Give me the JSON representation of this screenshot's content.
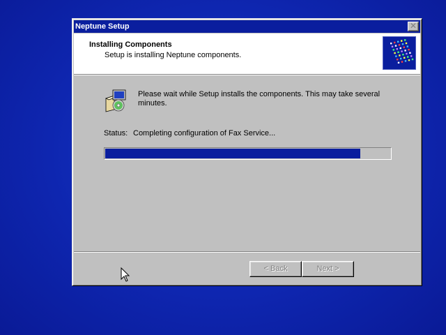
{
  "window": {
    "title": "Neptune Setup",
    "close_symbol": "✕"
  },
  "header": {
    "title": "Installing Components",
    "subtitle": "Setup is installing Neptune components.",
    "logo_icon": "setup-logo-icon"
  },
  "content": {
    "icon": "setup-computer-icon",
    "message": "Please wait while Setup installs the components.  This may take several minutes.",
    "status_label": "Status:",
    "status_value": "Completing configuration of Fax Service...",
    "progress": 0.895
  },
  "buttons": {
    "back_label": "< Back",
    "next_label": "Next >",
    "back_enabled": false,
    "next_enabled": false
  },
  "colors": {
    "desktop": "#0e26b0",
    "titlebar": "#0a1e9e",
    "progress_fill": "#0a1e9e",
    "dialog_face": "#c0c0c0"
  }
}
